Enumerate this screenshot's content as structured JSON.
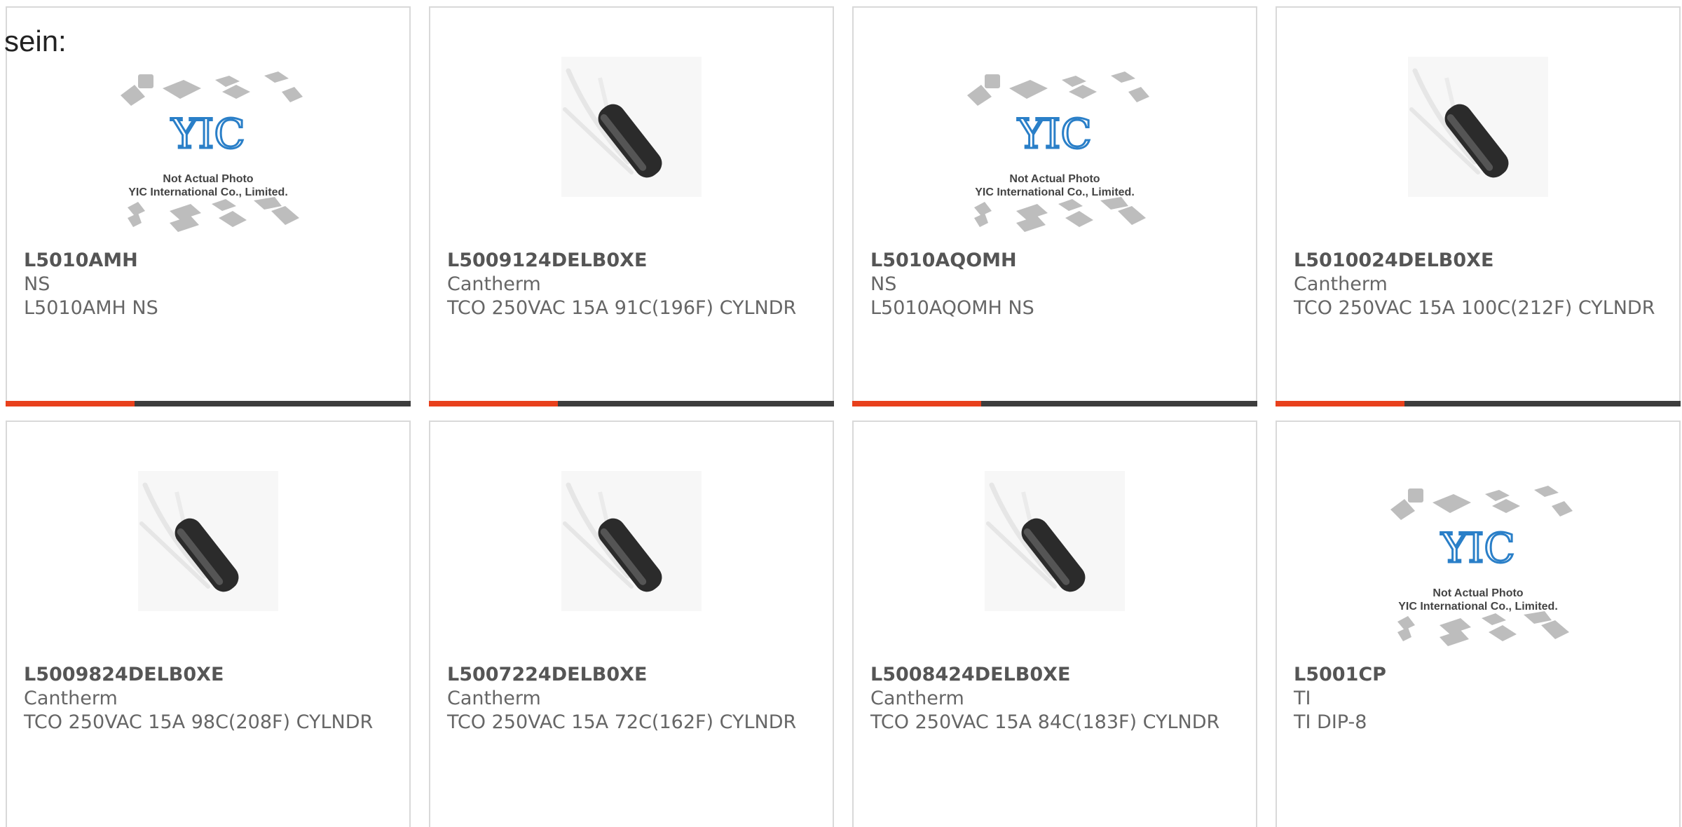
{
  "intro_text": "sein:",
  "placeholder": {
    "line1": "Not Actual Photo",
    "line2": "YIC International Co., Limited.",
    "logo": "YIC"
  },
  "colors": {
    "accent": "#e8401c",
    "bar_dark": "#3d3d3d",
    "logo_blue": "#2a7fc8"
  },
  "products": [
    {
      "pn": "L5010AMH",
      "mfr": "NS",
      "desc": "L5010AMH NS",
      "image": "placeholder"
    },
    {
      "pn": "L5009124DELB0XE",
      "mfr": "Cantherm",
      "desc": "TCO 250VAC 15A 91C(196F) CYLNDR",
      "image": "photo"
    },
    {
      "pn": "L5010AQOMH",
      "mfr": "NS",
      "desc": "L5010AQOMH NS",
      "image": "placeholder"
    },
    {
      "pn": "L5010024DELB0XE",
      "mfr": "Cantherm",
      "desc": "TCO 250VAC 15A 100C(212F) CYLNDR",
      "image": "photo"
    },
    {
      "pn": "L5009824DELB0XE",
      "mfr": "Cantherm",
      "desc": "TCO 250VAC 15A 98C(208F) CYLNDR",
      "image": "photo"
    },
    {
      "pn": "L5007224DELB0XE",
      "mfr": "Cantherm",
      "desc": "TCO 250VAC 15A 72C(162F) CYLNDR",
      "image": "photo"
    },
    {
      "pn": "L5008424DELB0XE",
      "mfr": "Cantherm",
      "desc": "TCO 250VAC 15A 84C(183F) CYLNDR",
      "image": "photo"
    },
    {
      "pn": "L5001CP",
      "mfr": "TI",
      "desc": "TI DIP-8",
      "image": "placeholder"
    }
  ]
}
